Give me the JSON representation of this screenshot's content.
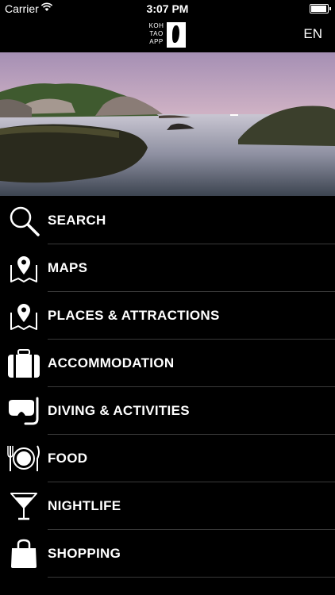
{
  "status": {
    "carrier": "Carrier",
    "time": "3:07 PM",
    "battery_level": 1.0
  },
  "header": {
    "logo_lines": [
      "KOH",
      "TAO",
      "APP"
    ],
    "language": "EN"
  },
  "hero": {
    "icon": "seascape-photo"
  },
  "menu": {
    "items": [
      {
        "label": "SEARCH",
        "icon": "search-icon"
      },
      {
        "label": "MAPS",
        "icon": "map-pin-icon"
      },
      {
        "label": "PLACES & ATTRACTIONS",
        "icon": "map-pin-icon"
      },
      {
        "label": "ACCOMMODATION",
        "icon": "suitcase-icon"
      },
      {
        "label": "DIVING & ACTIVITIES",
        "icon": "diving-mask-icon"
      },
      {
        "label": "FOOD",
        "icon": "plate-icon"
      },
      {
        "label": "NIGHTLIFE",
        "icon": "cocktail-icon"
      },
      {
        "label": "SHOPPING",
        "icon": "shopping-bag-icon"
      }
    ]
  }
}
